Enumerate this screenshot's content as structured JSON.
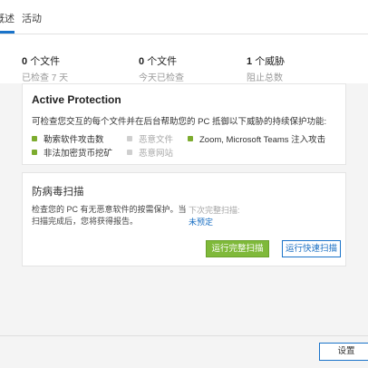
{
  "tabs": [
    {
      "label": "概述"
    },
    {
      "label": "活动"
    }
  ],
  "stats": [
    {
      "count": "0",
      "unit": "个文件",
      "sub": "已检查 7 天"
    },
    {
      "count": "0",
      "unit": "个文件",
      "sub": "今天已检查"
    },
    {
      "count": "1",
      "unit": "个威胁",
      "sub": "阻止总数"
    }
  ],
  "protection": {
    "title": "Active Protection",
    "description": "可检查您交互的每个文件并在后台帮助您的 PC 抵御以下威胁的持续保护功能:",
    "features": [
      {
        "label": "勒索软件攻击数",
        "enabled": true
      },
      {
        "label": "恶意文件",
        "enabled": false
      },
      {
        "label": "Zoom, Microsoft Teams 注入攻击",
        "enabled": true
      },
      {
        "label": "非法加密货币挖矿",
        "enabled": true
      },
      {
        "label": "恶意网站",
        "enabled": false
      }
    ]
  },
  "scan": {
    "title": "防病毒扫描",
    "description": "检查您的 PC 有无恶意软件的按需保护。当扫描完成后，您将获得报告。",
    "next_label": "下次完整扫描:",
    "next_value": "未预定",
    "full_button": "运行完整扫描",
    "quick_button": "运行快速扫描"
  },
  "footer": {
    "settings_button": "设置"
  },
  "colors": {
    "accent": "#1a73c9",
    "enabled_dot": "#7dac2f",
    "disabled_dot": "#cfcfcf",
    "primary_button": "#7fb93a"
  }
}
